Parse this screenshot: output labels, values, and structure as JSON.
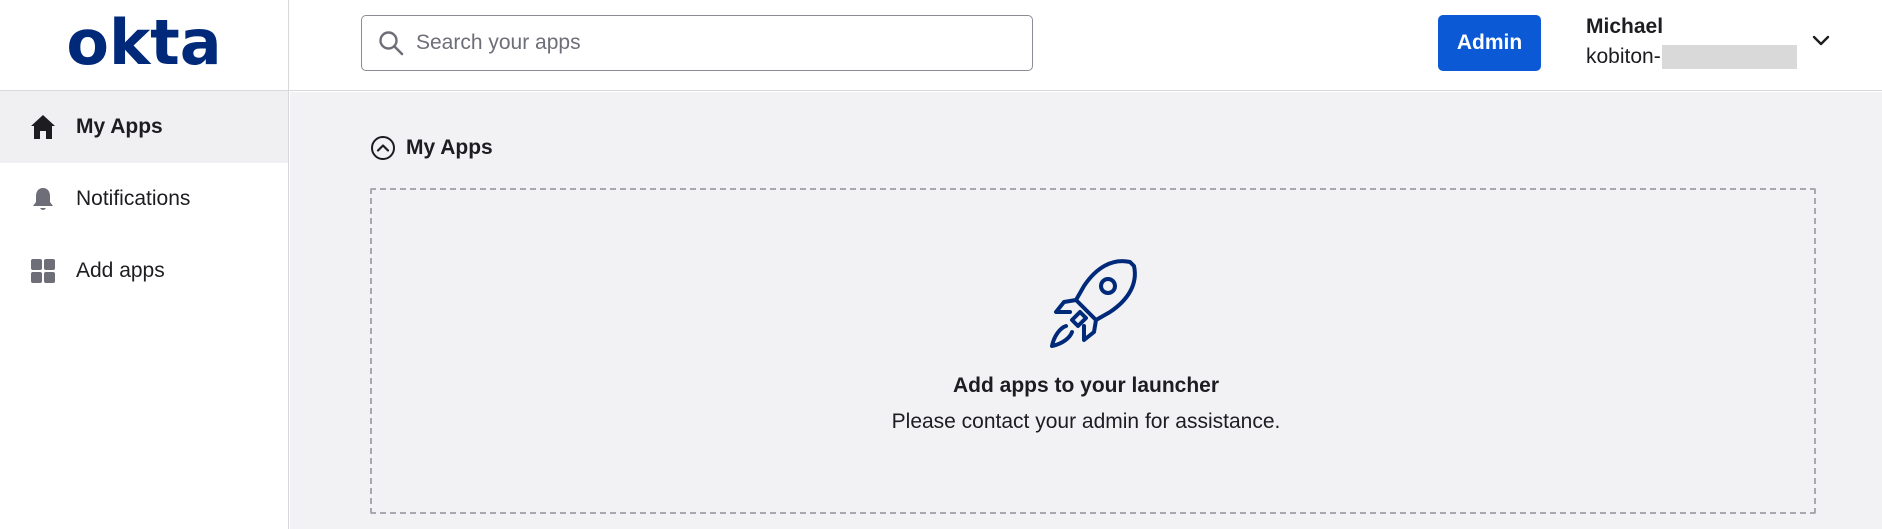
{
  "brand": {
    "logo_text": "okta",
    "color": "#00297a"
  },
  "search": {
    "placeholder": "Search your apps",
    "value": ""
  },
  "header": {
    "admin_label": "Admin",
    "admin_color": "#0b59d4",
    "user_name": "Michael",
    "user_org": "kobiton-"
  },
  "sidebar": {
    "items": [
      {
        "label": "My Apps",
        "icon": "home-icon",
        "active": true
      },
      {
        "label": "Notifications",
        "icon": "bell-icon",
        "active": false
      },
      {
        "label": "Add apps",
        "icon": "grid-icon",
        "active": false
      }
    ]
  },
  "main": {
    "section_title": "My Apps",
    "empty_title": "Add apps to your launcher",
    "empty_subtitle": "Please contact your admin for assistance.",
    "empty_icon": "rocket-icon"
  }
}
